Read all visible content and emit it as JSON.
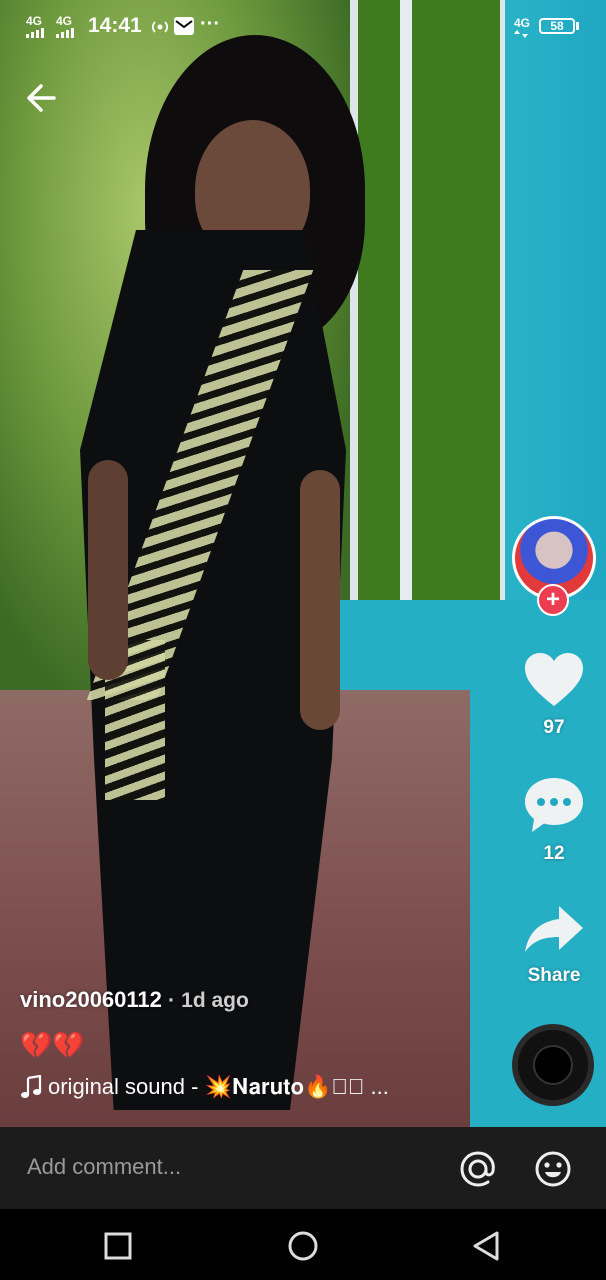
{
  "status_bar": {
    "net1": "4G",
    "net2": "4G",
    "time": "14:41",
    "net3": "4G",
    "battery": "58",
    "more": "···"
  },
  "post": {
    "username": "vino20060112",
    "separator": "·",
    "age": "1d ago",
    "caption": "💔💔",
    "sound": "original sound - 💥𝐍𝐚𝐫𝐮𝐭𝐨🔥▯🏻 ..."
  },
  "actions": {
    "likes": "97",
    "comments": "12",
    "share_label": "Share"
  },
  "comment_bar": {
    "placeholder": "Add comment..."
  },
  "icons": {
    "back": "arrow-left",
    "follow": "plus",
    "like": "heart",
    "comment": "speech-bubble",
    "share": "share-arrow",
    "mention": "at-sign",
    "emoji": "smiley",
    "nav": [
      "square-recents",
      "circle-home",
      "triangle-back"
    ]
  },
  "colors": {
    "follow_badge": "#ec3d52",
    "comment_bar_bg": "#1c1c1c"
  }
}
